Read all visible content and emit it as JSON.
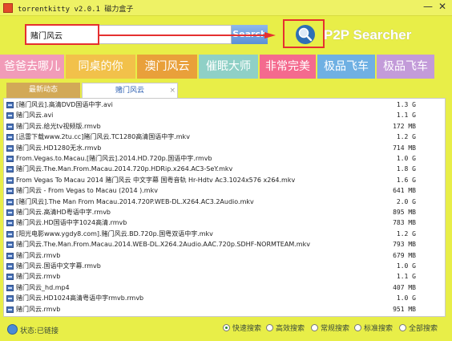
{
  "window": {
    "title": "torrentkitty v2.0.1 磁力盒子",
    "minimize": "—",
    "close": "✕"
  },
  "search": {
    "value": "赌门风云",
    "button_label": "Search",
    "brand": "P2P Searcher"
  },
  "tags": [
    {
      "label": "爸爸去哪儿",
      "color": "#f19bb8"
    },
    {
      "label": "同桌的你",
      "color": "#f2c14a"
    },
    {
      "label": "澳门风云",
      "color": "#e9a03a"
    },
    {
      "label": "催眠大师",
      "color": "#8fd0c6"
    },
    {
      "label": "非常完美",
      "color": "#f46a8e"
    },
    {
      "label": "极品飞车",
      "color": "#6fb0e3"
    },
    {
      "label": "极品飞车",
      "color": "#c39bd9"
    }
  ],
  "tabs": {
    "inactive": "最新动态",
    "active": "赌门风云",
    "close": "×"
  },
  "results": [
    {
      "name": "[赌门风云].高清DVD国语中字.avi",
      "size": "1.3 G"
    },
    {
      "name": "赌门风云.avi",
      "size": "1.1 G"
    },
    {
      "name": "赌门风云.给光tv视频版.rmvb",
      "size": "172 MB"
    },
    {
      "name": "[迅雷下载www.2tu.cc]赌门风云.TC1280高清国语中字.mkv",
      "size": "1.2 G"
    },
    {
      "name": "赌门风云.HD1280无水.rmvb",
      "size": "714 MB"
    },
    {
      "name": "From.Vegas.to.Macau.[赌门风云].2014.HD.720p.国语中字.rmvb",
      "size": "1.0 G"
    },
    {
      "name": "赌门风云.The.Man.From.Macau.2014.720p.HDRip.x264.AC3-SeY.mkv",
      "size": "1.8 G"
    },
    {
      "name": "From Vegas To Macau 2014 赌门风云 中文字幕 国粤音轨 Hr-Hdtv Ac3.1024x576 x264.mkv",
      "size": "1.6 G"
    },
    {
      "name": "赌门风云 - From Vegas to Macau (2014 ).mkv",
      "size": "641 MB"
    },
    {
      "name": "[赌门风云].The Man From Macau.2014.720P.WEB-DL.X264.AC3.2Audio.mkv",
      "size": "2.0 G"
    },
    {
      "name": "赌门风云.高清HD粤语中字.rmvb",
      "size": "895 MB"
    },
    {
      "name": "赌门风云.HD国语中字1024高清.rmvb",
      "size": "783 MB"
    },
    {
      "name": "[阳光电影www.ygdy8.com].赌门风云.BD.720p.国粤双语中字.mkv",
      "size": "1.2 G"
    },
    {
      "name": "赌门风云.The.Man.From.Macau.2014.WEB-DL.X264.2Audio.AAC.720p.SDHF-NORMTEAM.mkv",
      "size": "793 MB"
    },
    {
      "name": "赌门风云.rmvb",
      "size": "679 MB"
    },
    {
      "name": "赌门风云.国语中文字幕.rmvb",
      "size": "1.0 G"
    },
    {
      "name": "赌门风云.rmvb",
      "size": "1.1 G"
    },
    {
      "name": "赌门风云_hd.mp4",
      "size": "407 MB"
    },
    {
      "name": "赌门风云.HD1024高清粤语中字rmvb.rmvb",
      "size": "1.0 G"
    },
    {
      "name": "赌门风云.rmvb",
      "size": "951 MB"
    }
  ],
  "status": {
    "text": "状态:已链接",
    "modes": [
      {
        "label": "快速搜索",
        "selected": true
      },
      {
        "label": "高效搜索",
        "selected": false
      },
      {
        "label": "常规搜索",
        "selected": false
      },
      {
        "label": "标准搜索",
        "selected": false
      },
      {
        "label": "全部搜索",
        "selected": false
      }
    ]
  },
  "colors": {
    "frame": "#e8ee48",
    "highlight": "#e53030",
    "tab_inactive": "#d2a957",
    "search_button": "#6f9ee0"
  }
}
